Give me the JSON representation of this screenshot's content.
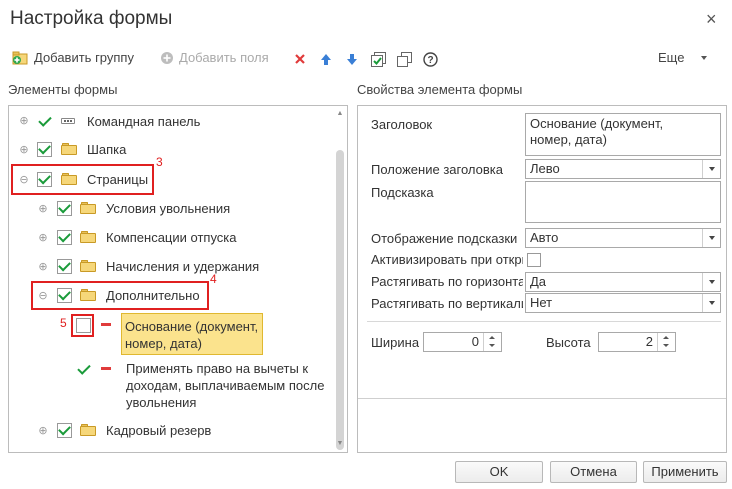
{
  "window": {
    "title": "Настройка формы",
    "close_glyph": "×"
  },
  "toolbar": {
    "add_group": "Добавить группу",
    "add_fields": "Добавить поля",
    "more": "Еще",
    "icons": [
      "add-group-icon",
      "add-fields-icon",
      "delete-icon",
      "move-up-icon",
      "move-down-icon",
      "check-all-icon",
      "copy-icon",
      "help-icon"
    ],
    "colors": {
      "delete": "#e03b3b",
      "arrows": "#3a7fd6",
      "check": "#1a9b3a"
    }
  },
  "left_panel": {
    "title": "Элементы формы"
  },
  "right_panel": {
    "title": "Свойства элемента формы"
  },
  "tree": {
    "items": [
      {
        "label": "Командная панель",
        "checked": true,
        "icon": "command-bar-icon"
      },
      {
        "label": "Шапка",
        "checked": true,
        "icon": "folder-icon"
      },
      {
        "label": "Страницы",
        "checked": true,
        "icon": "folder-icon",
        "expanded": true
      },
      {
        "label": "Условия увольнения",
        "checked": true,
        "icon": "folder-icon"
      },
      {
        "label": "Компенсации отпуска",
        "checked": true,
        "icon": "folder-icon"
      },
      {
        "label": "Начисления и удержания",
        "checked": true,
        "icon": "folder-icon"
      },
      {
        "label": "Дополнительно",
        "checked": true,
        "icon": "folder-icon",
        "expanded": true
      },
      {
        "label": "Основание (документ,\nномер, дата)",
        "checked": false,
        "icon": "field-dash-icon",
        "selected": true
      },
      {
        "label": "Применять право на вычеты к\nдоходам, выплачиваемым после\nувольнения",
        "checked": true,
        "icon": "field-dash-icon"
      },
      {
        "label": "Кадровый резерв",
        "checked": true,
        "icon": "folder-icon"
      }
    ],
    "expand_collapsed": "⊕",
    "expand_open": "⊖"
  },
  "annotations": {
    "n3": "3",
    "n4": "4",
    "n5": "5",
    "color": "#e02020"
  },
  "props": {
    "title_label": "Заголовок",
    "title_value": "Основание (документ,\nномер, дата)",
    "title_position_label": "Положение заголовка",
    "title_position_value": "Лево",
    "hint_label": "Подсказка",
    "hint_value": "",
    "hint_display_label": "Отображение подсказки",
    "hint_display_value": "Авто",
    "activate_label": "Активизировать при откры",
    "activate_checked": false,
    "stretch_h_label": "Растягивать по горизонтали",
    "stretch_h_value": "Да",
    "stretch_v_label": "Растягивать по вертикали",
    "stretch_v_value": "Нет",
    "width_label": "Ширина",
    "width_value": "0",
    "height_label": "Высота",
    "height_value": "2"
  },
  "buttons": {
    "ok": "OK",
    "cancel": "Отмена",
    "apply": "Применить"
  }
}
